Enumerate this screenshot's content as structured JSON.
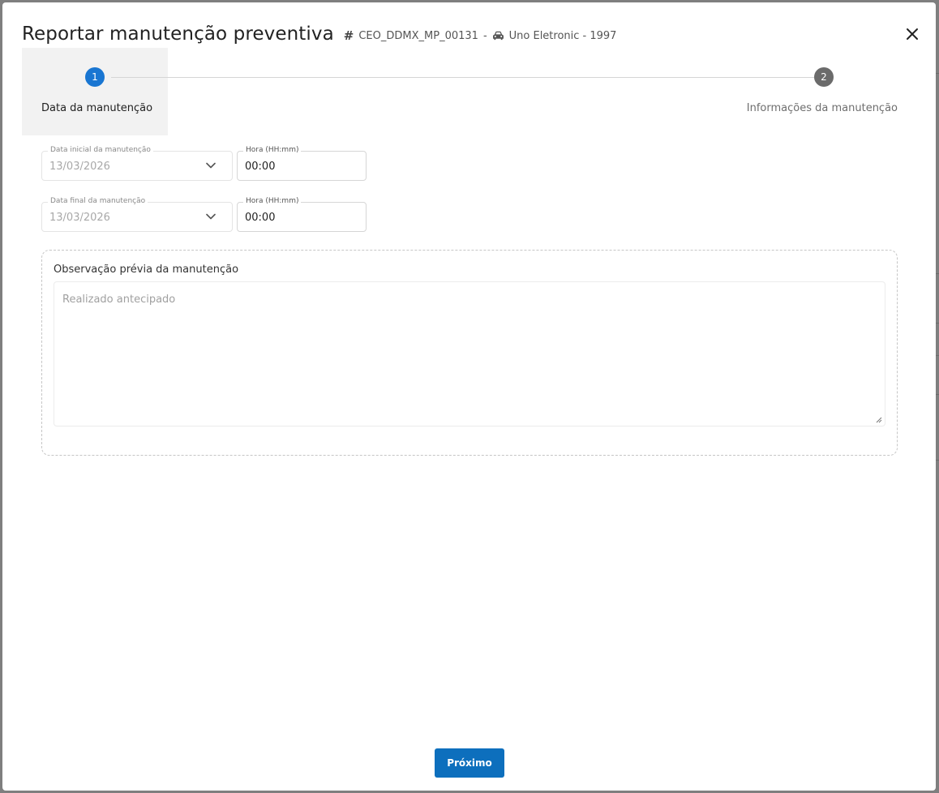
{
  "modal": {
    "title": "Reportar manutenção preventiva",
    "hash_symbol": "#",
    "code": "CEO_DDMX_MP_00131",
    "separator": "-",
    "vehicle": "Uno Eletronic - 1997",
    "close_icon": "close-icon"
  },
  "stepper": {
    "steps": [
      {
        "number": "1",
        "label": "Data da manutenção",
        "state": "active"
      },
      {
        "number": "2",
        "label": "Informações da manutenção",
        "state": "inactive"
      }
    ],
    "active_color": "#1976d2",
    "inactive_color": "#6b6b6b"
  },
  "form": {
    "start_date": {
      "label": "Data inicial da manutenção",
      "value": "13/03/2026"
    },
    "start_time": {
      "label": "Hora (HH:mm)",
      "value": "00:00"
    },
    "end_date": {
      "label": "Data final da manutenção",
      "value": "13/03/2026"
    },
    "end_time": {
      "label": "Hora (HH:mm)",
      "value": "00:00"
    },
    "observation": {
      "label": "Observação prévia da manutenção",
      "placeholder": "Realizado antecipado"
    }
  },
  "footer": {
    "next_label": "Próximo",
    "button_color": "#0d6fbd"
  }
}
